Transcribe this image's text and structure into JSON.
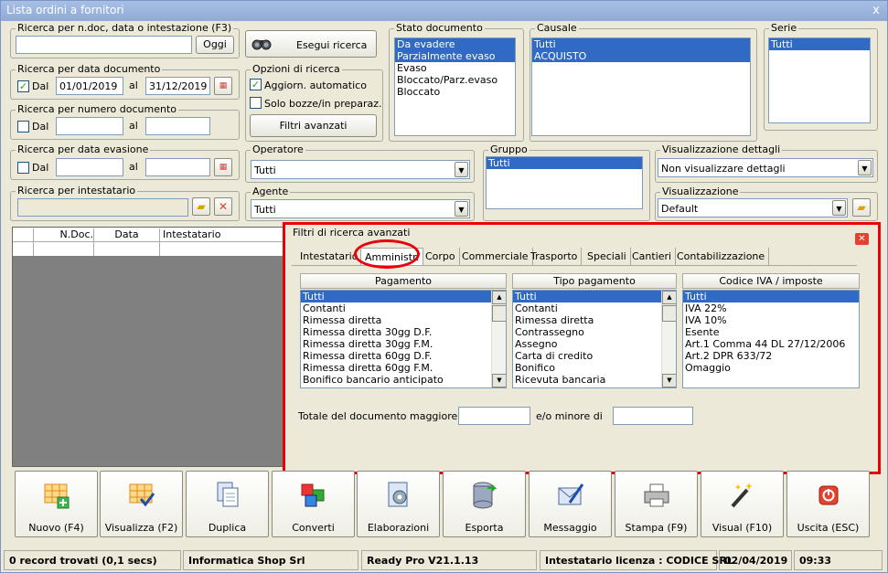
{
  "window": {
    "title": "Lista ordini a fornitori",
    "close_glyph": "x"
  },
  "search_text": {
    "label": "Ricerca per n.doc, data o intestazione (F3)",
    "value": "",
    "ok_button": "Oggi"
  },
  "run_search": {
    "label": "Esegui ricerca",
    "icon": "binoculars-icon"
  },
  "doc_date": {
    "label": "Ricerca per data documento",
    "dal_label": "Dal",
    "dal_checked": true,
    "from": "01/01/2019",
    "al_label": "al",
    "to": "31/12/2019"
  },
  "doc_number": {
    "label": "Ricerca per numero documento",
    "dal_label": "Dal",
    "dal_checked": false,
    "from": "",
    "al_label": "al",
    "to": ""
  },
  "evasion_date": {
    "label": "Ricerca per data evasione",
    "dal_label": "Dal",
    "dal_checked": false,
    "from": "",
    "al_label": "al",
    "to": ""
  },
  "holder": {
    "label": "Ricerca per intestatario",
    "value": ""
  },
  "search_options": {
    "label": "Opzioni di ricerca",
    "auto_update": "Aggiorn. automatico",
    "auto_update_checked": true,
    "drafts": "Solo bozze/in preparaz.",
    "drafts_checked": false,
    "advanced_button": "Filtri avanzati"
  },
  "doc_state": {
    "label": "Stato documento",
    "items": [
      "Da evadere",
      "Parzialmente evaso",
      "Evaso",
      "Bloccato/Parz.evaso",
      "Bloccato"
    ],
    "selected": [
      0,
      1
    ]
  },
  "causale": {
    "label": "Causale",
    "items": [
      "Tutti",
      "ACQUISTO"
    ],
    "selected": [
      0,
      1
    ]
  },
  "serie": {
    "label": "Serie",
    "items": [
      "Tutti"
    ],
    "selected": [
      0
    ]
  },
  "operator": {
    "label": "Operatore",
    "value": "Tutti"
  },
  "agent": {
    "label": "Agente",
    "value": "Tutti"
  },
  "group": {
    "label": "Gruppo",
    "items": [
      "Tutti"
    ],
    "selected": [
      0
    ]
  },
  "detail_view": {
    "label": "Visualizzazione dettagli",
    "value": "Non visualizzare dettagli"
  },
  "view": {
    "label": "Visualizzazione",
    "value": "Default"
  },
  "grid": {
    "columns": [
      "N.Doc.",
      "Data",
      "Intestatario"
    ]
  },
  "advanced_filters": {
    "title": "Filtri di ricerca avanzati",
    "tabs": [
      "Intestatario",
      "Amministr.",
      "Corpo",
      "Commerciale",
      "Trasporto",
      "Speciali",
      "Cantieri",
      "Contabilizzazione"
    ],
    "active_tab": "Amministr.",
    "payment": {
      "header": "Pagamento",
      "items": [
        "Tutti",
        "Contanti",
        "Rimessa diretta",
        "Rimessa diretta 30gg D.F.",
        "Rimessa diretta 30gg F.M.",
        "Rimessa diretta 60gg D.F.",
        "Rimessa diretta 60gg F.M.",
        "Bonifico bancario anticipato"
      ],
      "selected": 0
    },
    "payment_type": {
      "header": "Tipo pagamento",
      "items": [
        "Tutti",
        "Contanti",
        "Rimessa diretta",
        "Contrassegno",
        "Assegno",
        "Carta di credito",
        "Bonifico",
        "Ricevuta bancaria"
      ],
      "selected": 0
    },
    "vat": {
      "header": "Codice IVA / imposte",
      "items": [
        "Tutti",
        "IVA 22%",
        "IVA 10%",
        "Esente",
        "Art.1 Comma 44 DL 27/12/2006",
        "Art.2 DPR 633/72",
        "Omaggio"
      ],
      "selected": 0
    },
    "total_greater_label": "Totale del documento maggiore di",
    "total_greater": "",
    "total_less_label": "e/o minore di",
    "total_less": ""
  },
  "toolbar": [
    "Nuovo (F4)",
    "Visualizza (F2)",
    "Duplica",
    "Converti",
    "Elaborazioni",
    "Esporta",
    "Messaggio",
    "Stampa (F9)",
    "Visual (F10)",
    "Uscita (ESC)"
  ],
  "status": {
    "records": "0 record trovati (0,1 secs)",
    "company": "Informatica Shop Srl",
    "version": "Ready Pro V21.1.13",
    "license": "Intestatario licenza : CODICE SRL",
    "date": "02/04/2019",
    "time": "09:33"
  },
  "highlight_color": "#e8000b"
}
